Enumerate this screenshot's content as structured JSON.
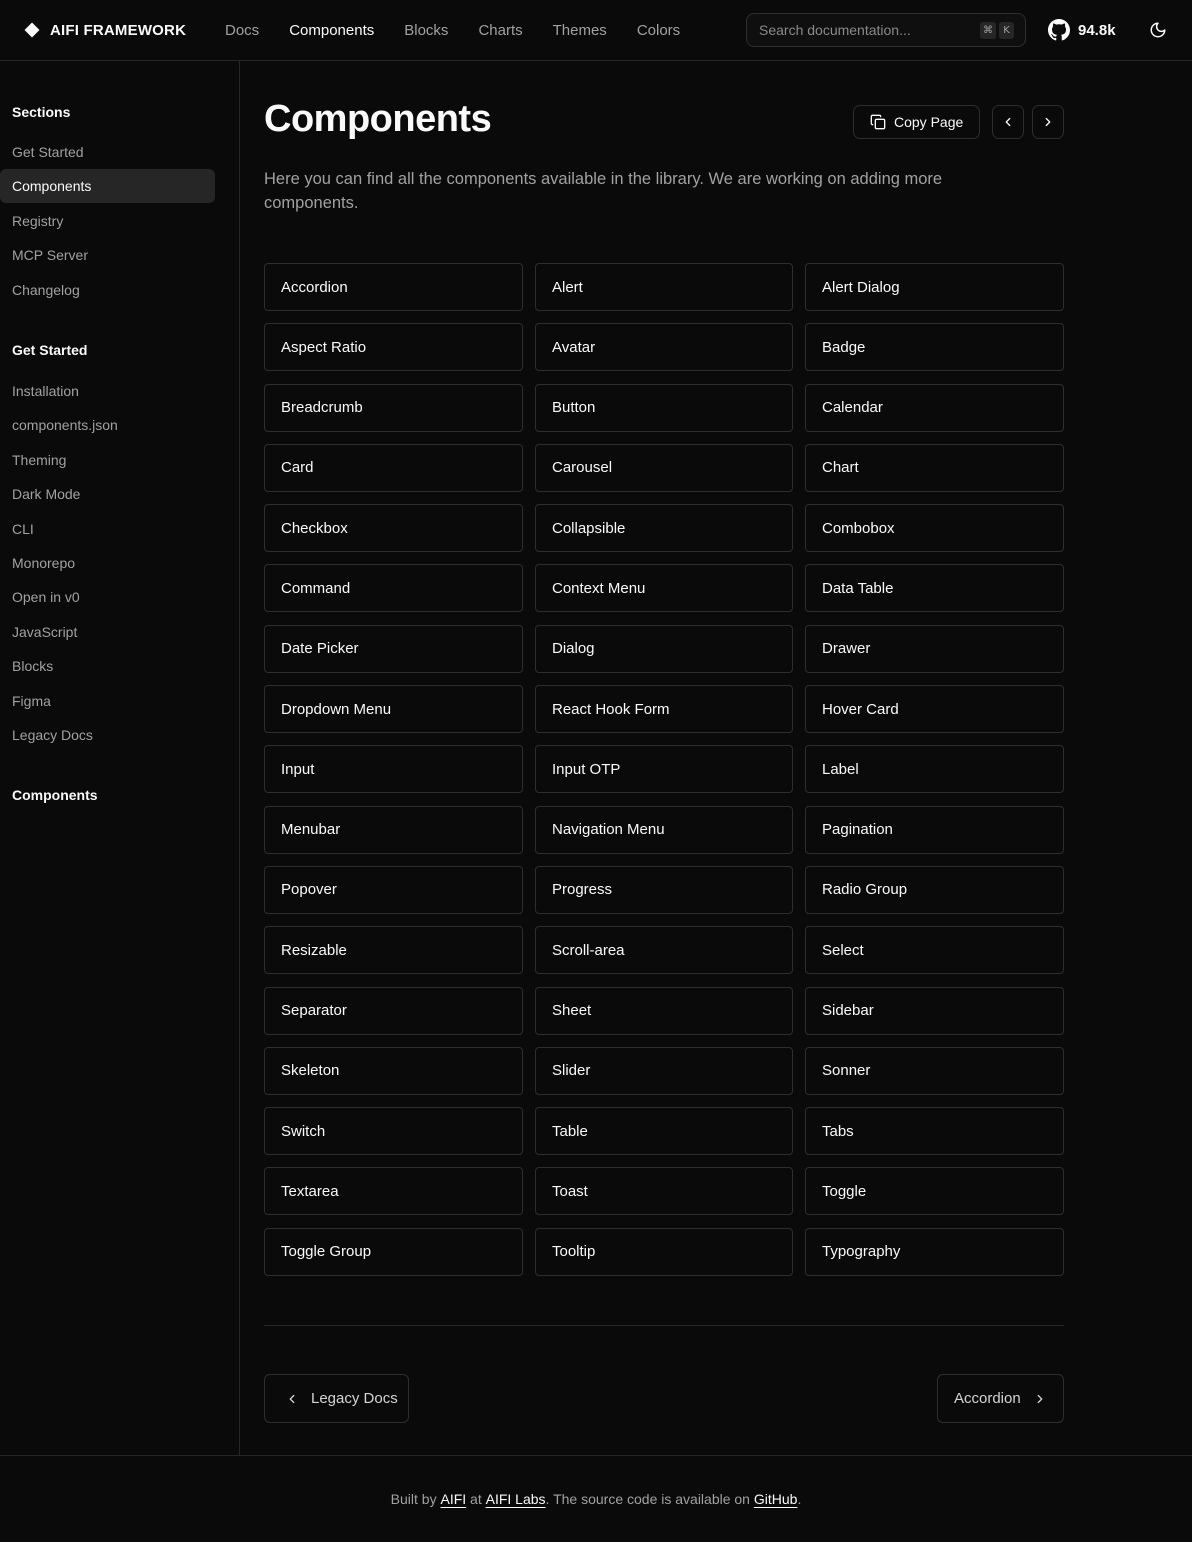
{
  "brand": {
    "name": "AIFI FRAMEWORK"
  },
  "header": {
    "nav": [
      {
        "label": "Docs",
        "active": false
      },
      {
        "label": "Components",
        "active": true
      },
      {
        "label": "Blocks",
        "active": false
      },
      {
        "label": "Charts",
        "active": false
      },
      {
        "label": "Themes",
        "active": false
      },
      {
        "label": "Colors",
        "active": false
      }
    ],
    "search": {
      "placeholder": "Search documentation...",
      "shortcut_mod": "⌘",
      "shortcut_key": "K"
    },
    "github_stars": "94.8k",
    "icons": {
      "github": "github-icon",
      "theme": "moon-icon"
    }
  },
  "sidebar": {
    "sections_heading": "Sections",
    "sections": [
      {
        "label": "Get Started",
        "active": false
      },
      {
        "label": "Components",
        "active": true
      },
      {
        "label": "Registry",
        "active": false
      },
      {
        "label": "MCP Server",
        "active": false
      },
      {
        "label": "Changelog",
        "active": false
      }
    ],
    "get_started_heading": "Get Started",
    "get_started": [
      "Installation",
      "components.json",
      "Theming",
      "Dark Mode",
      "CLI",
      "Monorepo",
      "Open in v0",
      "JavaScript",
      "Blocks",
      "Figma",
      "Legacy Docs"
    ],
    "components_heading": "Components"
  },
  "main": {
    "title": "Components",
    "copy_label": "Copy Page",
    "description": "Here you can find all the components available in the library. We are working on adding more components.",
    "components": [
      "Accordion",
      "Alert",
      "Alert Dialog",
      "Aspect Ratio",
      "Avatar",
      "Badge",
      "Breadcrumb",
      "Button",
      "Calendar",
      "Card",
      "Carousel",
      "Chart",
      "Checkbox",
      "Collapsible",
      "Combobox",
      "Command",
      "Context Menu",
      "Data Table",
      "Date Picker",
      "Dialog",
      "Drawer",
      "Dropdown Menu",
      "React Hook Form",
      "Hover Card",
      "Input",
      "Input OTP",
      "Label",
      "Menubar",
      "Navigation Menu",
      "Pagination",
      "Popover",
      "Progress",
      "Radio Group",
      "Resizable",
      "Scroll-area",
      "Select",
      "Separator",
      "Sheet",
      "Sidebar",
      "Skeleton",
      "Slider",
      "Sonner",
      "Switch",
      "Table",
      "Tabs",
      "Textarea",
      "Toast",
      "Toggle",
      "Toggle Group",
      "Tooltip",
      "Typography"
    ],
    "prev_label": "Legacy Docs",
    "next_label": "Accordion"
  },
  "footer": {
    "t1": "Built by ",
    "link1": "AIFI",
    "t2": " at ",
    "link2": "AIFI Labs",
    "t3": ". The source code is available on ",
    "link3": "GitHub",
    "t4": "."
  }
}
